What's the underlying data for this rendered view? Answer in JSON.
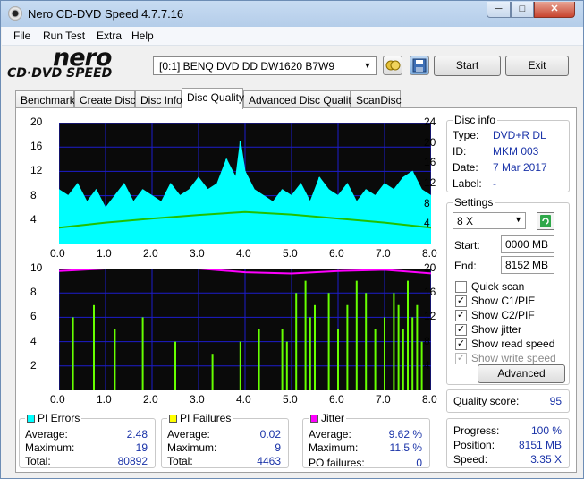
{
  "window": {
    "title": "Nero CD-DVD Speed 4.7.7.16",
    "min": "─",
    "max": "□",
    "close": "✕"
  },
  "menu": [
    "File",
    "Run Test",
    "Extra",
    "Help"
  ],
  "logo": {
    "line1": "nero",
    "line2": "CD·DVD SPEED"
  },
  "drive": {
    "selected": "[0:1]   BENQ DVD DD DW1620 B7W9"
  },
  "buttons": {
    "start": "Start",
    "exit": "Exit",
    "advanced": "Advanced"
  },
  "tabs": [
    "Benchmark",
    "Create Disc",
    "Disc Info",
    "Disc Quality",
    "Advanced Disc Quality",
    "ScanDisc"
  ],
  "active_tab": "Disc Quality",
  "disc_info": {
    "title": "Disc info",
    "type_label": "Type:",
    "type": "DVD+R DL",
    "id_label": "ID:",
    "id": "MKM 003",
    "date_label": "Date:",
    "date": "7 Mar 2017",
    "label_label": "Label:",
    "label": "-"
  },
  "settings": {
    "title": "Settings",
    "speed": "8 X",
    "start_label": "Start:",
    "start": "0000 MB",
    "end_label": "End:",
    "end": "8152 MB",
    "checks": [
      {
        "label": "Quick scan",
        "checked": false,
        "disabled": false
      },
      {
        "label": "Show C1/PIE",
        "checked": true,
        "disabled": false
      },
      {
        "label": "Show C2/PIF",
        "checked": true,
        "disabled": false
      },
      {
        "label": "Show jitter",
        "checked": true,
        "disabled": false
      },
      {
        "label": "Show read speed",
        "checked": true,
        "disabled": false
      },
      {
        "label": "Show write speed",
        "checked": true,
        "disabled": true
      }
    ]
  },
  "quality": {
    "label": "Quality score:",
    "value": "95"
  },
  "progress": {
    "progress_label": "Progress:",
    "progress": "100 %",
    "position_label": "Position:",
    "position": "8151 MB",
    "speed_label": "Speed:",
    "speed": "3.35 X"
  },
  "pi_errors": {
    "title": "PI Errors",
    "color": "#00ffff",
    "average_label": "Average:",
    "average": "2.48",
    "maximum_label": "Maximum:",
    "maximum": "19",
    "total_label": "Total:",
    "total": "80892"
  },
  "pi_failures": {
    "title": "PI Failures",
    "color": "#ffff00",
    "average_label": "Average:",
    "average": "0.02",
    "maximum_label": "Maximum:",
    "maximum": "9",
    "total_label": "Total:",
    "total": "4463"
  },
  "jitter": {
    "title": "Jitter",
    "color": "#ff00ff",
    "average_label": "Average:",
    "average": "9.62 %",
    "maximum_label": "Maximum:",
    "maximum": "11.5 %",
    "po_label": "PO failures:",
    "po": "0"
  },
  "chart_data": [
    {
      "type": "area",
      "x_ticks": [
        "0.0",
        "1.0",
        "2.0",
        "3.0",
        "4.0",
        "5.0",
        "6.0",
        "7.0",
        "8.0"
      ],
      "y_left_ticks": [
        "20",
        "16",
        "12",
        "8",
        "4"
      ],
      "y_right_ticks": [
        "24",
        "20",
        "16",
        "12",
        "8",
        "4"
      ],
      "xlim": [
        0,
        8
      ],
      "ylim_left": [
        0,
        20
      ],
      "ylim_right": [
        0,
        24
      ],
      "series": [
        {
          "color": "#00ffff",
          "x": [
            0.0,
            0.2,
            0.4,
            0.6,
            0.8,
            1.0,
            1.2,
            1.4,
            1.6,
            1.8,
            2.0,
            2.2,
            2.4,
            2.6,
            2.8,
            3.0,
            3.2,
            3.4,
            3.6,
            3.8,
            3.9,
            4.0,
            4.2,
            4.4,
            4.6,
            4.8,
            5.0,
            5.2,
            5.4,
            5.6,
            5.8,
            6.0,
            6.2,
            6.4,
            6.6,
            6.8,
            7.0,
            7.2,
            7.4,
            7.6,
            7.8,
            8.0
          ],
          "values": [
            9,
            8,
            10,
            7,
            9,
            6,
            8,
            10,
            7,
            9,
            8,
            7,
            10,
            8,
            9,
            11,
            9,
            10,
            14,
            11,
            17,
            12,
            9,
            8,
            7,
            9,
            8,
            10,
            7,
            11,
            9,
            8,
            10,
            7,
            9,
            8,
            10,
            9,
            11,
            12,
            9,
            8
          ]
        },
        {
          "color": "#22c000",
          "x": [
            0.0,
            1.0,
            2.0,
            3.0,
            4.0,
            5.0,
            6.0,
            7.0,
            8.0
          ],
          "values": [
            3.3,
            4.3,
            5.1,
            5.8,
            6.4,
            5.9,
            5.1,
            4.3,
            3.3
          ]
        }
      ]
    },
    {
      "type": "bar",
      "x_ticks": [
        "0.0",
        "1.0",
        "2.0",
        "3.0",
        "4.0",
        "5.0",
        "6.0",
        "7.0",
        "8.0"
      ],
      "y_left_ticks": [
        "10",
        "8",
        "6",
        "4",
        "2"
      ],
      "y_right_ticks": [
        "20",
        "16",
        "12",
        "8",
        "4"
      ],
      "xlim": [
        0,
        8
      ],
      "ylim_left": [
        0,
        10
      ],
      "ylim_right": [
        0,
        20
      ],
      "series": [
        {
          "color": "#66ff00",
          "x": [
            0.3,
            0.75,
            1.2,
            1.8,
            2.5,
            3.3,
            3.9,
            4.3,
            4.8,
            4.9,
            5.1,
            5.3,
            5.4,
            5.5,
            5.8,
            6.0,
            6.2,
            6.4,
            6.6,
            6.8,
            7.0,
            7.2,
            7.3,
            7.4,
            7.5,
            7.6,
            7.7,
            7.8
          ],
          "values": [
            6,
            7,
            5,
            6,
            4,
            3,
            4,
            5,
            5,
            4,
            8,
            9,
            6,
            7,
            8,
            5,
            7,
            9,
            8,
            5,
            6,
            8,
            7,
            5,
            9,
            6,
            7,
            4
          ]
        },
        {
          "color": "#ff00ff",
          "x": [
            0.0,
            1.0,
            2.0,
            3.0,
            4.0,
            5.0,
            6.0,
            7.0,
            8.0
          ],
          "values": [
            9.8,
            10.0,
            10.1,
            10.0,
            9.7,
            9.6,
            9.8,
            9.9,
            9.6
          ]
        }
      ]
    }
  ]
}
